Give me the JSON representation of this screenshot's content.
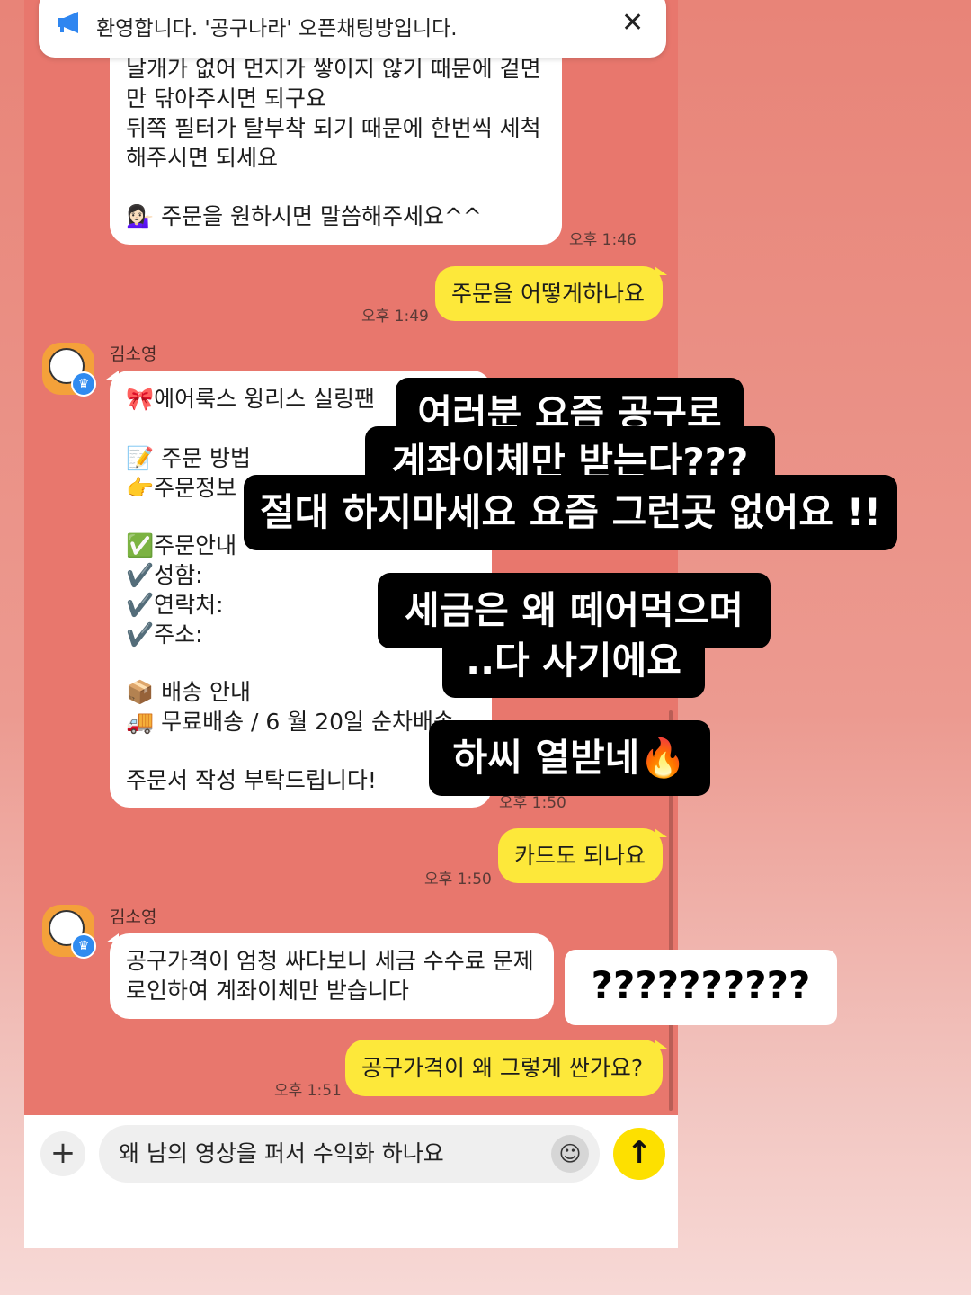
{
  "banner": {
    "text": "환영합니다. '공구나라' 오픈채팅방입니다.",
    "icon": "megaphone-icon",
    "close": "✕"
  },
  "messages": {
    "m1": {
      "lines": [
        "날개가 없어 먼지가 쌓이지 않기 때문에 겉면",
        "만 닦아주시면 되구요",
        "뒤쪽 필터가 탈부착 되기 때문에 한번씩 세척",
        "해주시면 되세요"
      ],
      "order_line": "💁🏻‍♀️ 주문을 원하시면 말씀해주세요^^",
      "time": "오후 1:46"
    },
    "m2": {
      "text": "주문을 어떻게하나요",
      "time": "오후 1:49"
    },
    "m3": {
      "sender": "김소영",
      "lines": [
        "🎀에어룩스 윙리스 실링팬",
        "",
        "📝 주문 방법",
        "👉주문정보",
        "",
        "✅주문안내",
        "✔️성함:",
        "✔️연락처:",
        "✔️주소:",
        "",
        "📦 배송 안내",
        "🚚 무료배송 / 6 월  20일  순차배송",
        "",
        "주문서 작성 부탁드립니다!"
      ],
      "time": "오후 1:50"
    },
    "m4": {
      "text": "카드도 되나요",
      "time": "오후 1:50"
    },
    "m5": {
      "sender": "김소영",
      "lines": [
        "공구가격이 엄청 싸다보니 세금 수수료 문제",
        "로인하여  계좌이체만  받습니다"
      ]
    },
    "m6": {
      "text": "공구가격이 왜 그렇게 싼가요?",
      "time": "오후 1:51"
    }
  },
  "overlays": {
    "o1": [
      "여러분 요즘 공구로",
      "계좌이체만 받는다???",
      "절대 하지마세요 요즘 그런곳 없어요 !!"
    ],
    "o2": [
      "세금은 왜 떼어먹으며",
      "..다 사기에요"
    ],
    "o3": "하씨 열받네🔥",
    "o4": "??????????"
  },
  "input": {
    "text": "왜 남의 영상을 퍼서 수익화 하나요",
    "plus": "+",
    "emoji": "☺",
    "send": "↑"
  },
  "colors": {
    "chat_bg": "#e8776d",
    "my_bubble": "#fde83a",
    "other_bubble": "#ffffff",
    "send_button": "#fde000"
  }
}
